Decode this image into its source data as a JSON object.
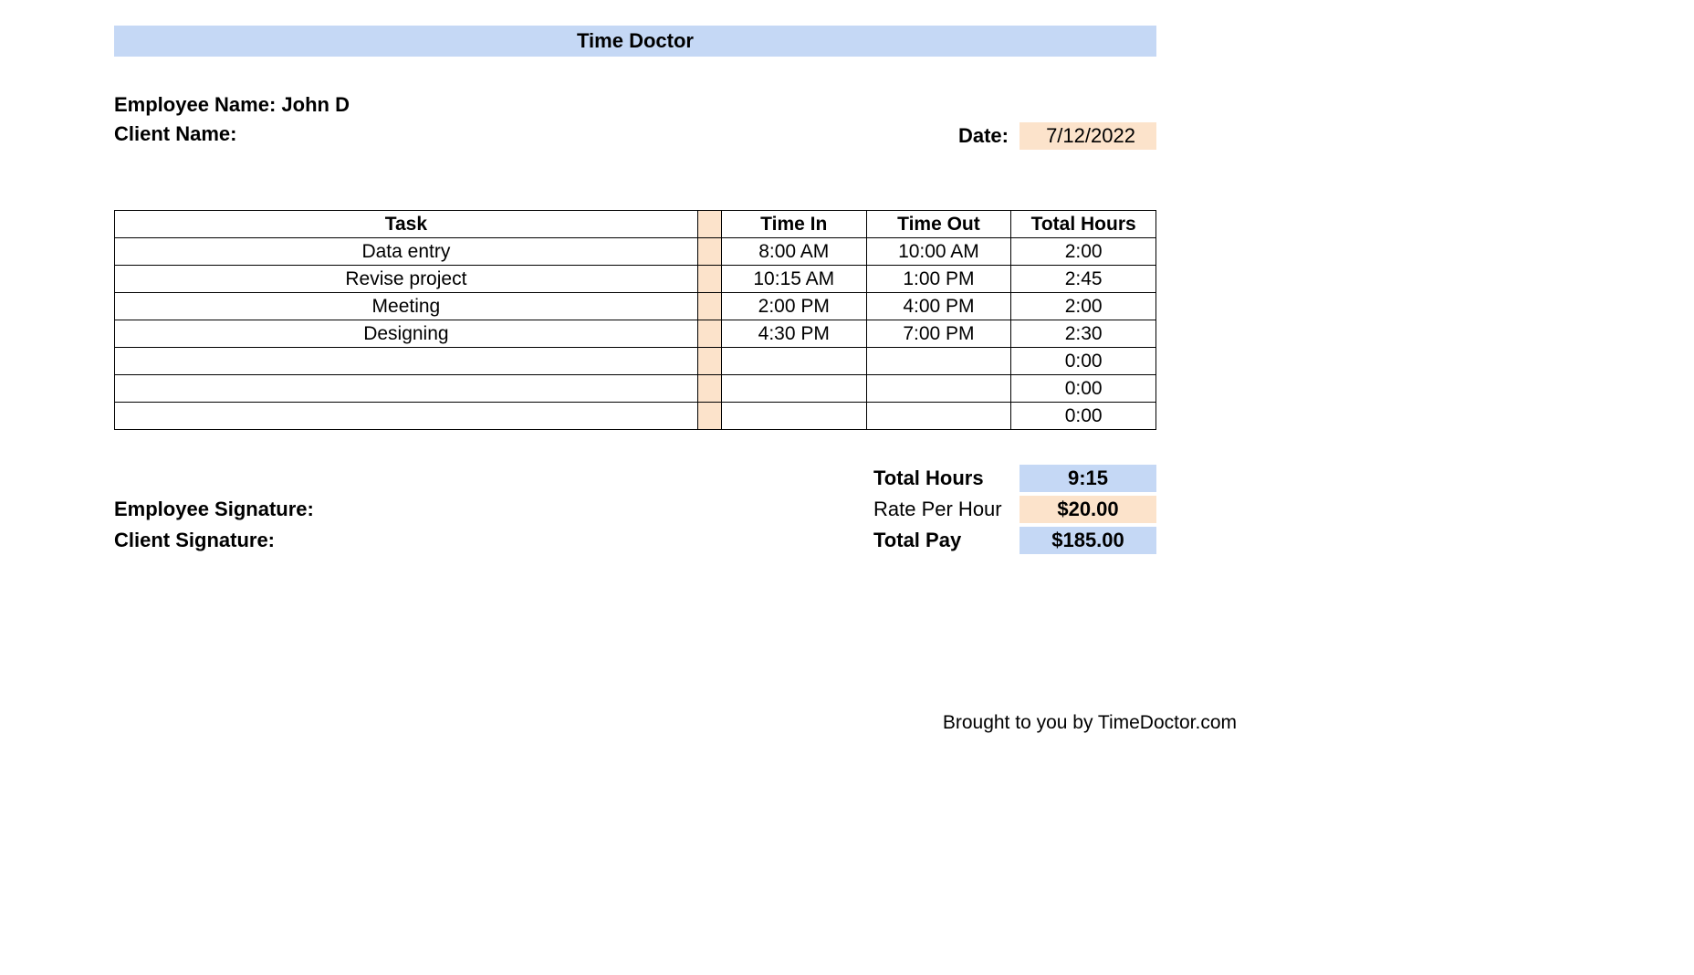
{
  "title": "Time Doctor",
  "employee_name_full": "Employee Name: John D",
  "client_name_label": "Client Name:",
  "date_label": "Date:",
  "date_value": "7/12/2022",
  "columns": {
    "task": "Task",
    "time_in": "Time In",
    "time_out": "Time Out",
    "total_hours": "Total Hours"
  },
  "rows": [
    {
      "task": "Data entry",
      "time_in": "8:00 AM",
      "time_out": "10:00 AM",
      "total": "2:00"
    },
    {
      "task": "Revise project",
      "time_in": "10:15 AM",
      "time_out": "1:00 PM",
      "total": "2:45"
    },
    {
      "task": "Meeting",
      "time_in": "2:00 PM",
      "time_out": "4:00 PM",
      "total": "2:00"
    },
    {
      "task": "Designing",
      "time_in": "4:30 PM",
      "time_out": "7:00 PM",
      "total": "2:30"
    },
    {
      "task": "",
      "time_in": "",
      "time_out": "",
      "total": "0:00"
    },
    {
      "task": "",
      "time_in": "",
      "time_out": "",
      "total": "0:00"
    },
    {
      "task": "",
      "time_in": "",
      "time_out": "",
      "total": "0:00"
    }
  ],
  "signatures": {
    "employee": "Employee Signature:",
    "client": "Client Signature:"
  },
  "summary": {
    "total_hours_label": "Total Hours",
    "total_hours_value": "9:15",
    "rate_label": "Rate Per Hour",
    "rate_value": "$20.00",
    "total_pay_label": "Total Pay",
    "total_pay_value": "$185.00"
  },
  "footer": "Brought to you by TimeDoctor.com"
}
